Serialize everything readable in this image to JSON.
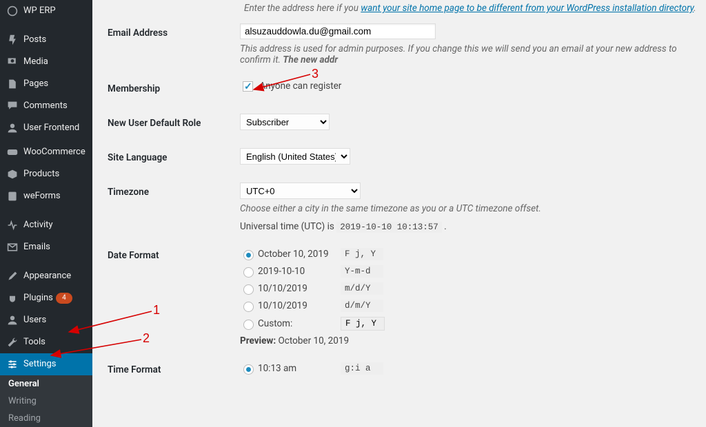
{
  "sidebar": {
    "items": [
      {
        "label": "WP ERP",
        "icon": "erp"
      },
      {
        "label": "Posts",
        "icon": "pin"
      },
      {
        "label": "Media",
        "icon": "media"
      },
      {
        "label": "Pages",
        "icon": "page"
      },
      {
        "label": "Comments",
        "icon": "comment"
      },
      {
        "label": "User Frontend",
        "icon": "user"
      },
      {
        "label": "WooCommerce",
        "icon": "woo"
      },
      {
        "label": "Products",
        "icon": "box"
      },
      {
        "label": "weForms",
        "icon": "forms"
      },
      {
        "label": "Activity",
        "icon": "activity"
      },
      {
        "label": "Emails",
        "icon": "mail"
      },
      {
        "label": "Appearance",
        "icon": "brush"
      },
      {
        "label": "Plugins",
        "icon": "plug",
        "badge": "4"
      },
      {
        "label": "Users",
        "icon": "users"
      },
      {
        "label": "Tools",
        "icon": "wrench"
      },
      {
        "label": "Settings",
        "icon": "sliders"
      }
    ],
    "sub": [
      "General",
      "Writing",
      "Reading"
    ]
  },
  "intro_text": "Enter the address here if you ",
  "intro_link": "want your site home page to be different from your WordPress installation directory",
  "rows": {
    "email_label": "Email Address",
    "email_value": "alsuzauddowla.du@gmail.com",
    "email_desc_1": "This address is used for admin purposes. If you change this we will send you an email at your new address to confirm it. ",
    "email_desc_2": "The new addr",
    "membership_label": "Membership",
    "membership_option": "Anyone can register",
    "role_label": "New User Default Role",
    "role_value": "Subscriber",
    "lang_label": "Site Language",
    "lang_value": "English (United States)",
    "tz_label": "Timezone",
    "tz_value": "UTC+0",
    "tz_desc": "Choose either a city in the same timezone as you or a UTC timezone offset.",
    "utc_prefix": "Universal time (UTC) is ",
    "utc_value": "2019-10-10 10:13:57",
    "df_label": "Date Format",
    "df_options": [
      {
        "label": "October 10, 2019",
        "code": "F j, Y"
      },
      {
        "label": "2019-10-10",
        "code": "Y-m-d"
      },
      {
        "label": "10/10/2019",
        "code": "m/d/Y"
      },
      {
        "label": "10/10/2019",
        "code": "d/m/Y"
      }
    ],
    "df_custom_label": "Custom:",
    "df_custom_value": "F j, Y",
    "df_preview_label": "Preview: ",
    "df_preview_value": "October 10, 2019",
    "tf_label": "Time Format",
    "tf_option_label": "10:13 am",
    "tf_option_code": "g:i a"
  },
  "annotations": {
    "n1": "1",
    "n2": "2",
    "n3": "3"
  }
}
